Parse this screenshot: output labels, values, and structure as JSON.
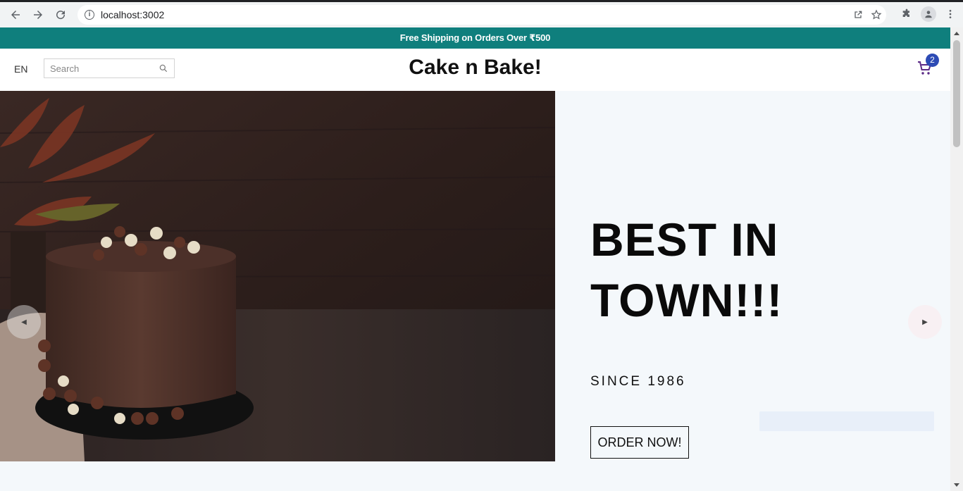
{
  "browser": {
    "url": "localhost:3002",
    "icons": [
      "back-icon",
      "forward-icon",
      "reload-icon",
      "info-icon",
      "share-icon",
      "star-icon",
      "extensions-icon",
      "profile-icon",
      "menu-icon"
    ]
  },
  "announcement": {
    "text": "Free Shipping on Orders Over ₹500"
  },
  "navbar": {
    "language": "EN",
    "search_placeholder": "Search",
    "logo": "Cake n Bake!",
    "cart_count": "2"
  },
  "hero": {
    "headline": "BEST IN TOWN!!!",
    "subtitle": "SINCE 1986",
    "cta": "ORDER NOW!",
    "prev_arrow": "◀",
    "next_arrow": "▶"
  },
  "colors": {
    "announcement_bg": "#0f7f7d",
    "badge_bg": "#2d4bb5",
    "hero_bg": "#f4f8fb"
  }
}
